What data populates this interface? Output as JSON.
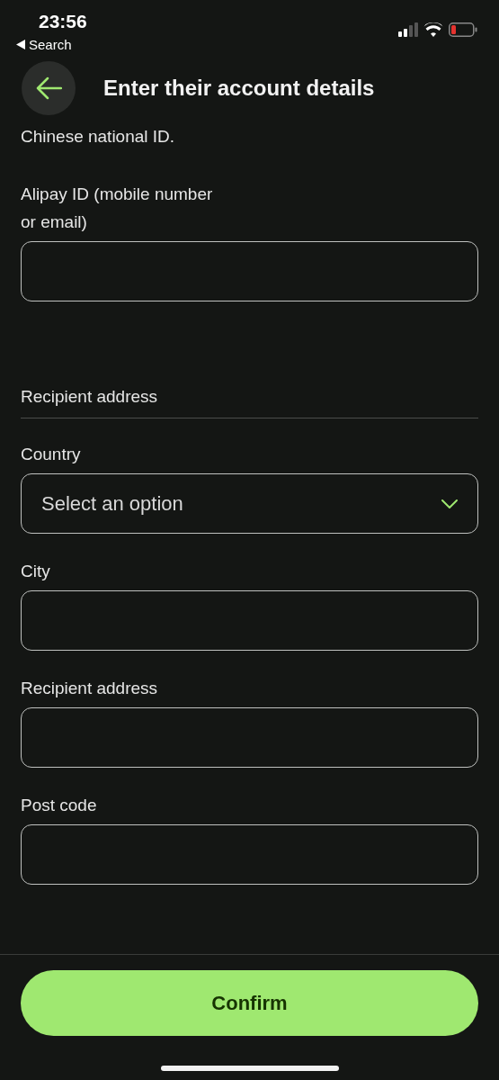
{
  "status_bar": {
    "time": "23:56",
    "back_label": "Search"
  },
  "header": {
    "title": "Enter their account details"
  },
  "intro": "Chinese national ID.",
  "top_fields": [
    {
      "kind": "text",
      "label": "Alipay ID (mobile number or email)"
    }
  ],
  "section": {
    "title": "Recipient address"
  },
  "fields": [
    {
      "kind": "select",
      "label": "Country",
      "placeholder": "Select an option"
    },
    {
      "kind": "text",
      "label": "City"
    },
    {
      "kind": "text",
      "label": "Recipient address"
    },
    {
      "kind": "text",
      "label": "Post code"
    }
  ],
  "confirm": "Confirm"
}
